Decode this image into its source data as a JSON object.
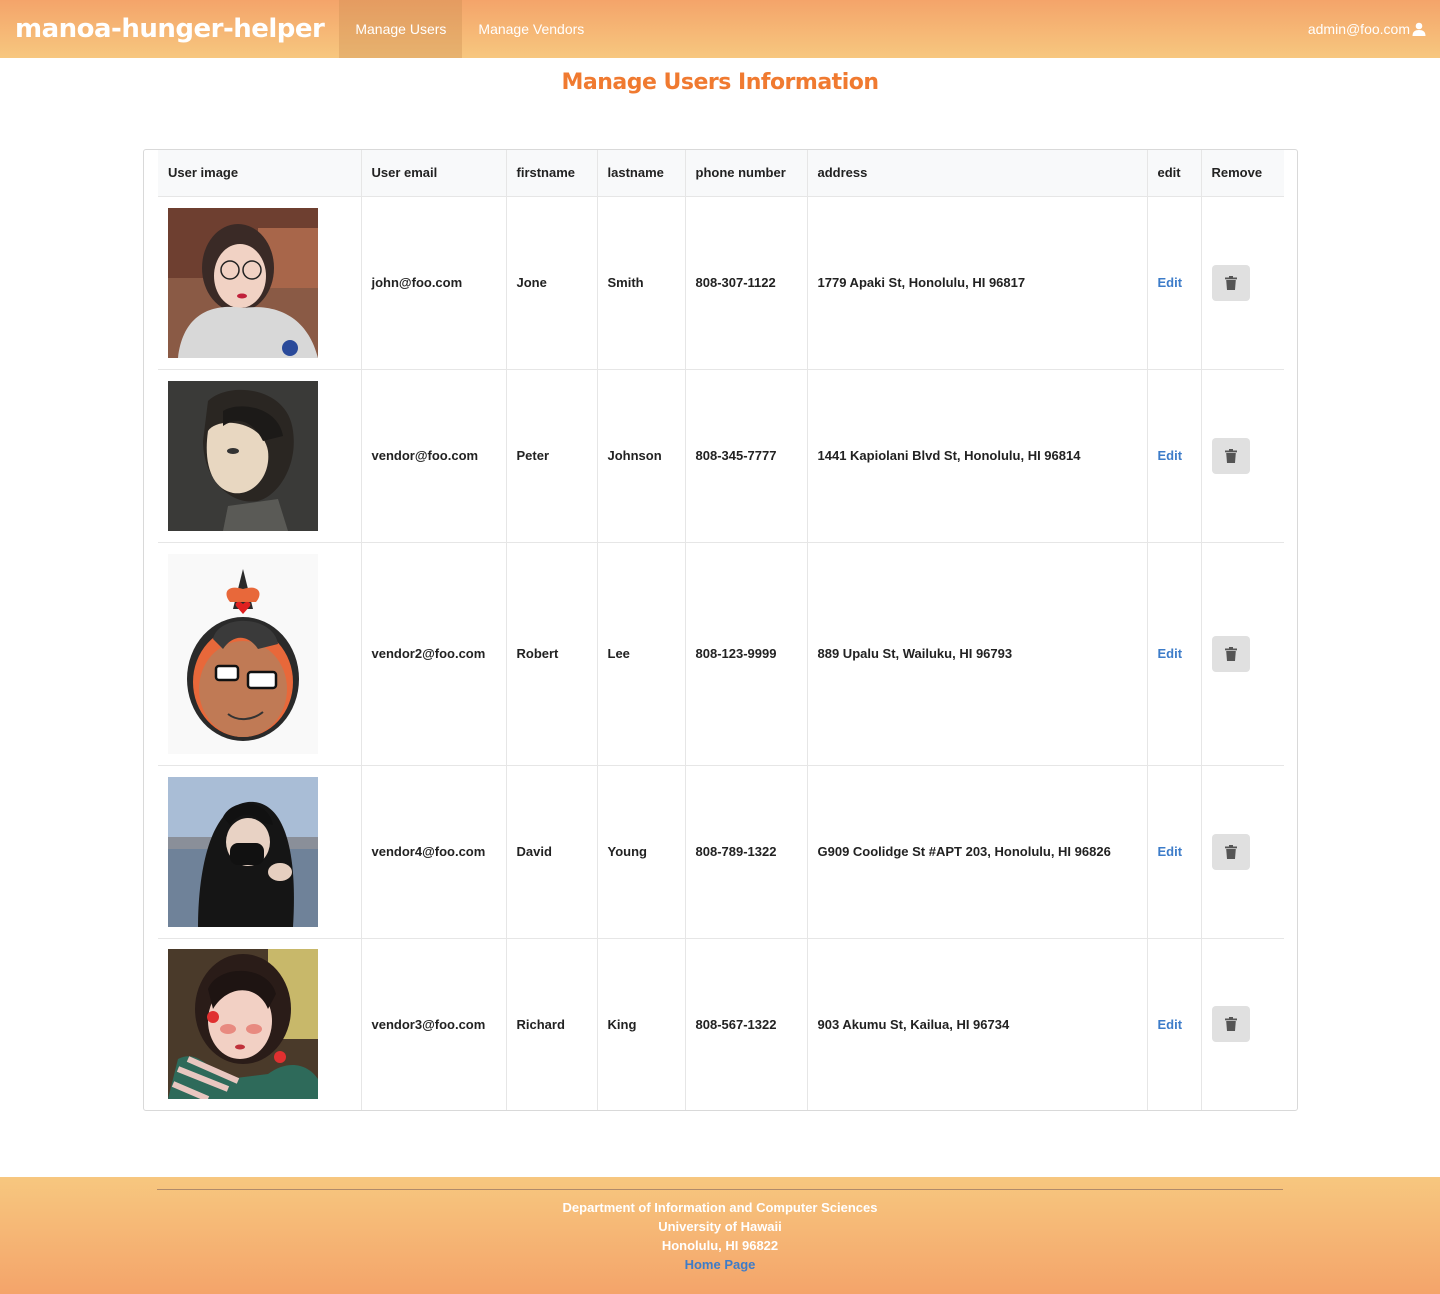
{
  "navbar": {
    "brand": "manoa-hunger-helper",
    "items": [
      {
        "label": "Manage Users",
        "active": true
      },
      {
        "label": "Manage Vendors",
        "active": false
      }
    ],
    "user": "admin@foo.com",
    "user_icon": "user-icon",
    "colors": {
      "gradient_top": "#f4a46a",
      "gradient_bottom": "#f7c77f"
    }
  },
  "page": {
    "title": "Manage Users Information",
    "title_color": "#f07a30"
  },
  "table": {
    "headers": [
      "User image",
      "User email",
      "firstname",
      "lastname",
      "phone number",
      "address",
      "edit",
      "Remove"
    ],
    "rows": [
      {
        "email": "john@foo.com",
        "firstname": "Jone",
        "lastname": "Smith",
        "phone": "808-307-1122",
        "address": "1779 Apaki St, Honolulu, HI 96817",
        "edit": "Edit"
      },
      {
        "email": "vendor@foo.com",
        "firstname": "Peter",
        "lastname": "Johnson",
        "phone": "808-345-7777",
        "address": "1441 Kapiolani Blvd St, Honolulu, HI 96814",
        "edit": "Edit"
      },
      {
        "email": "vendor2@foo.com",
        "firstname": "Robert",
        "lastname": "Lee",
        "phone": "808-123-9999",
        "address": "889 Upalu St, Wailuku, HI 96793",
        "edit": "Edit"
      },
      {
        "email": "vendor4@foo.com",
        "firstname": "David",
        "lastname": "Young",
        "phone": "808-789-1322",
        "address": "G909 Coolidge St #APT 203, Honolulu, HI 96826",
        "edit": "Edit"
      },
      {
        "email": "vendor3@foo.com",
        "firstname": "Richard",
        "lastname": "King",
        "phone": "808-567-1322",
        "address": "903 Akumu St, Kailua, HI 96734",
        "edit": "Edit"
      }
    ],
    "edit_color": "#3d7cc9",
    "remove_icon": "trash-icon"
  },
  "footer": {
    "line1": "Department of Information and Computer Sciences",
    "line2": "University of Hawaii",
    "line3": "Honolulu, HI 96822",
    "link": "Home Page"
  }
}
